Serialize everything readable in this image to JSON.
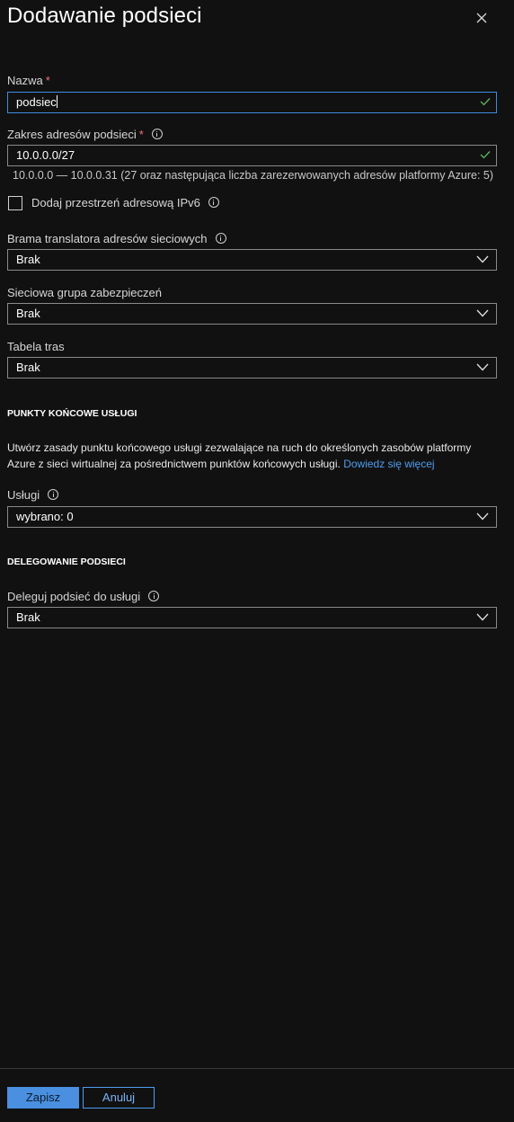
{
  "header": {
    "title": "Dodawanie podsieci"
  },
  "name_field": {
    "label": "Nazwa",
    "required_mark": "*",
    "value": "podsiec"
  },
  "address_field": {
    "label": "Zakres adresów podsieci",
    "required_mark": "*",
    "value": "10.0.0.0/27",
    "hint": "10.0.0.0 — 10.0.0.31 (27 oraz następująca liczba zarezerwowanych adresów platformy Azure: 5)"
  },
  "ipv6": {
    "label": "Dodaj przestrzeń adresową IPv6",
    "checked": false
  },
  "nat_gateway": {
    "label": "Brama translatora adresów sieciowych",
    "value": "Brak"
  },
  "nsg": {
    "label": "Sieciowa grupa zabezpieczeń",
    "value": "Brak"
  },
  "route_table": {
    "label": "Tabela tras",
    "value": "Brak"
  },
  "service_endpoints": {
    "heading": "PUNKTY KOŃCOWE USŁUGI",
    "description": "Utwórz zasady punktu końcowego usługi zezwalające na ruch do określonych zasobów platformy Azure z sieci wirtualnej za pośrednictwem punktów końcowych usługi.",
    "learn_more": "Dowiedz się więcej",
    "services_label": "Usługi",
    "services_value": "wybrano: 0"
  },
  "delegation": {
    "heading": "DELEGOWANIE PODSIECI",
    "label": "Deleguj podsieć do usługi",
    "value": "Brak"
  },
  "footer": {
    "save_label": "Zapisz",
    "cancel_label": "Anuluj"
  },
  "colors": {
    "accent": "#4a8fe0",
    "link": "#4f9df0",
    "valid": "#5fb65f",
    "required": "#f1707b",
    "background": "#111111"
  },
  "icons": {
    "close": "close-icon",
    "info": "info-icon",
    "check": "checkmark-icon",
    "dropdown": "chevron-down-icon"
  }
}
